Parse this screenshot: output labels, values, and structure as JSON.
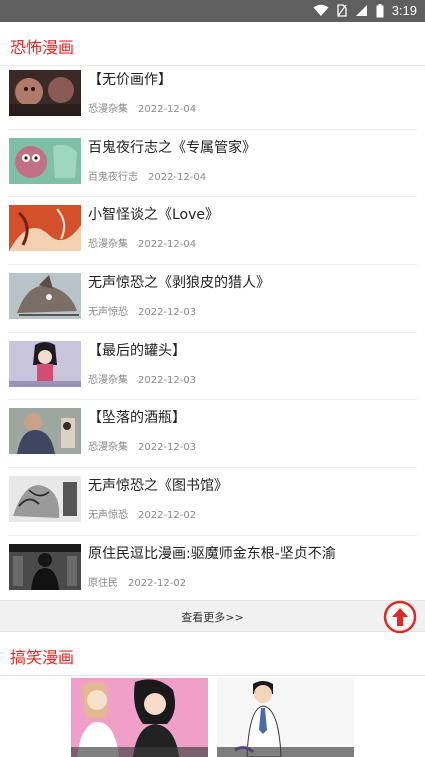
{
  "status_bar": {
    "time": "3:19",
    "icons": [
      "wifi-icon",
      "sim-icon",
      "signal-icon",
      "battery-icon"
    ]
  },
  "sections": {
    "horror": {
      "title": "恐怖漫画"
    },
    "funny": {
      "title": "搞笑漫画"
    }
  },
  "horror_items": [
    {
      "title": "【无价画作】",
      "source": "恐漫杂集",
      "date": "2022-12-04"
    },
    {
      "title": "百鬼夜行志之《专属管家》",
      "source": "百鬼夜行志",
      "date": "2022-12-04"
    },
    {
      "title": "小智怪谈之《Love》",
      "source": "恐漫杂集",
      "date": "2022-12-04"
    },
    {
      "title": "无声惊恐之《剥狼皮的猎人》",
      "source": "无声惊恐",
      "date": "2022-12-03"
    },
    {
      "title": "【最后的罐头】",
      "source": "恐漫杂集",
      "date": "2022-12-03"
    },
    {
      "title": "【坠落的酒瓶】",
      "source": "恐漫杂集",
      "date": "2022-12-03"
    },
    {
      "title": "无声惊恐之《图书馆》",
      "source": "无声惊恐",
      "date": "2022-12-02"
    },
    {
      "title": "原住民逗比漫画:驱魔师金东根-坚贞不渝",
      "source": "原住民",
      "date": "2022-12-02"
    }
  ],
  "more_label": "查看更多>>",
  "funny_cards": [
    {
      "caption": ""
    },
    {
      "caption": ""
    }
  ],
  "colors": {
    "accent": "#e02a2a",
    "statusbar": "#5f5f5f"
  },
  "icons": {
    "back_to_top": "arrow-up-circle-icon"
  }
}
